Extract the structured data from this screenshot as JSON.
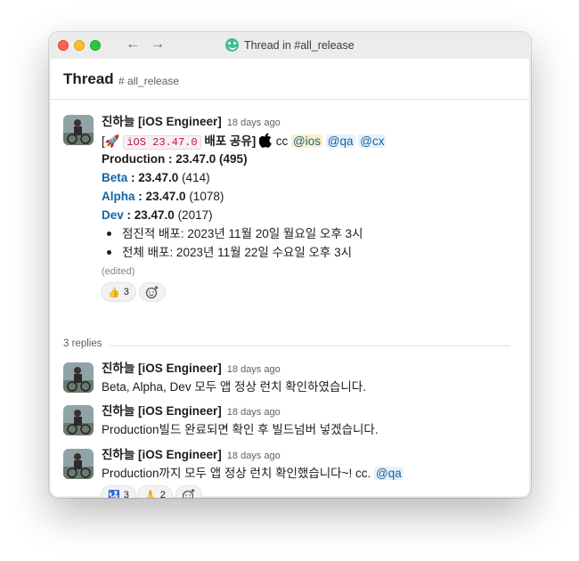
{
  "window": {
    "title": "Thread in #all_release",
    "back_icon": "arrow-left-icon",
    "forward_icon": "arrow-right-icon"
  },
  "thread": {
    "title": "Thread",
    "channel": "all_release"
  },
  "parent": {
    "author": "진하늘 [iOS Engineer]",
    "time": "18 days ago",
    "line1": {
      "open": "[",
      "rocket": "🚀",
      "version_code": "iOS 23.47.0",
      "label": " 배포 공유]",
      "apple": "",
      "cc": " cc ",
      "mentions": [
        "@ios",
        "@qa",
        "@cx"
      ]
    },
    "production": {
      "label": "Production : 23.47.0",
      "build": " (495)"
    },
    "beta": {
      "name": "Beta",
      "sep": " : ",
      "version": "23.47.0",
      "build": " (414)"
    },
    "alpha": {
      "name": "Alpha",
      "sep": " : ",
      "version": "23.47.0",
      "build": " (1078)"
    },
    "dev": {
      "name": "Dev",
      "sep": " : ",
      "version": "23.47.0",
      "build": " (2017)"
    },
    "bullets": [
      "점진적 배포: 2023년 11월 20일 월요일 오후 3시",
      "전체 배포: 2023년 11월 22일 수요일 오후 3시"
    ],
    "edited": "(edited)",
    "reactions": [
      {
        "emoji": "👍",
        "count": "3"
      }
    ]
  },
  "replies_label": "3 replies",
  "replies": [
    {
      "author": "진하늘 [iOS Engineer]",
      "time": "18 days ago",
      "text": "Beta, Alpha, Dev 모두 앱 정상 런치 확인하였습니다."
    },
    {
      "author": "진하늘 [iOS Engineer]",
      "time": "18 days ago",
      "text": "Production빌드 완료되면 확인 후 빌드넘버 넣겠습니다."
    },
    {
      "author": "진하늘 [iOS Engineer]",
      "time": "18 days ago",
      "text": "Production까지 모두 앱 정상 런치 확인했습니다~! cc. ",
      "mention": "@qa",
      "reactions": [
        {
          "emoji": "🛂",
          "count": "3"
        },
        {
          "emoji": "🙏",
          "count": "2"
        }
      ]
    }
  ]
}
